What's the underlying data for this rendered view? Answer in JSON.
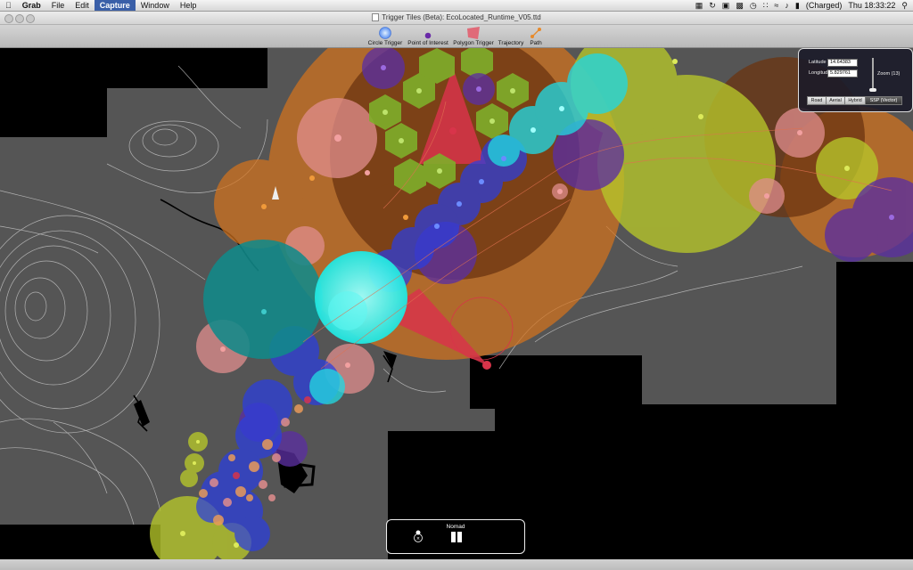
{
  "menubar": {
    "apple": "",
    "items": [
      "Grab",
      "File",
      "Edit",
      "Capture",
      "Window",
      "Help"
    ],
    "active_item": "Capture",
    "battery": "(Charged)",
    "clock": "Thu 18:33:22"
  },
  "window": {
    "title": "Trigger Tiles (Beta): EcoLocated_Runtime_V05.ttd"
  },
  "toolbar": {
    "circle_trigger": "Circle Trigger",
    "point_of_interest": "Point of Interest",
    "polygon_trigger": "Polygon Trigger",
    "trajectory": "Trajectory",
    "path": "Path"
  },
  "location_panel": {
    "latitude_label": "Latitude",
    "latitude_value": "14.64383",
    "longitude_label": "Longitude",
    "longitude_value": "5.829761",
    "zoom_label": "Zoom (13)",
    "map_types": [
      "Road",
      "Aerial",
      "Hybrid",
      "SSP (Vector)"
    ],
    "selected_map_type": "SSP (Vector)"
  },
  "nomad": {
    "label": "Nomad"
  },
  "colors": {
    "orange": "#d4731d",
    "brown": "#6b3410",
    "green": "#7fae2a",
    "blue": "#2b3ee0",
    "cyan": "#20e6e0",
    "teal": "#118a8a",
    "purple": "#5b2fa0",
    "yellow_green": "#b7c72a",
    "pink": "#e08d8d",
    "red": "#d8344a",
    "land": "#555555"
  },
  "icons": {
    "circle_trigger": "circle-trigger-icon",
    "point_of_interest": "point-of-interest-icon",
    "polygon_trigger": "polygon-trigger-icon",
    "trajectory": "trajectory-icon",
    "path": "path-icon"
  }
}
